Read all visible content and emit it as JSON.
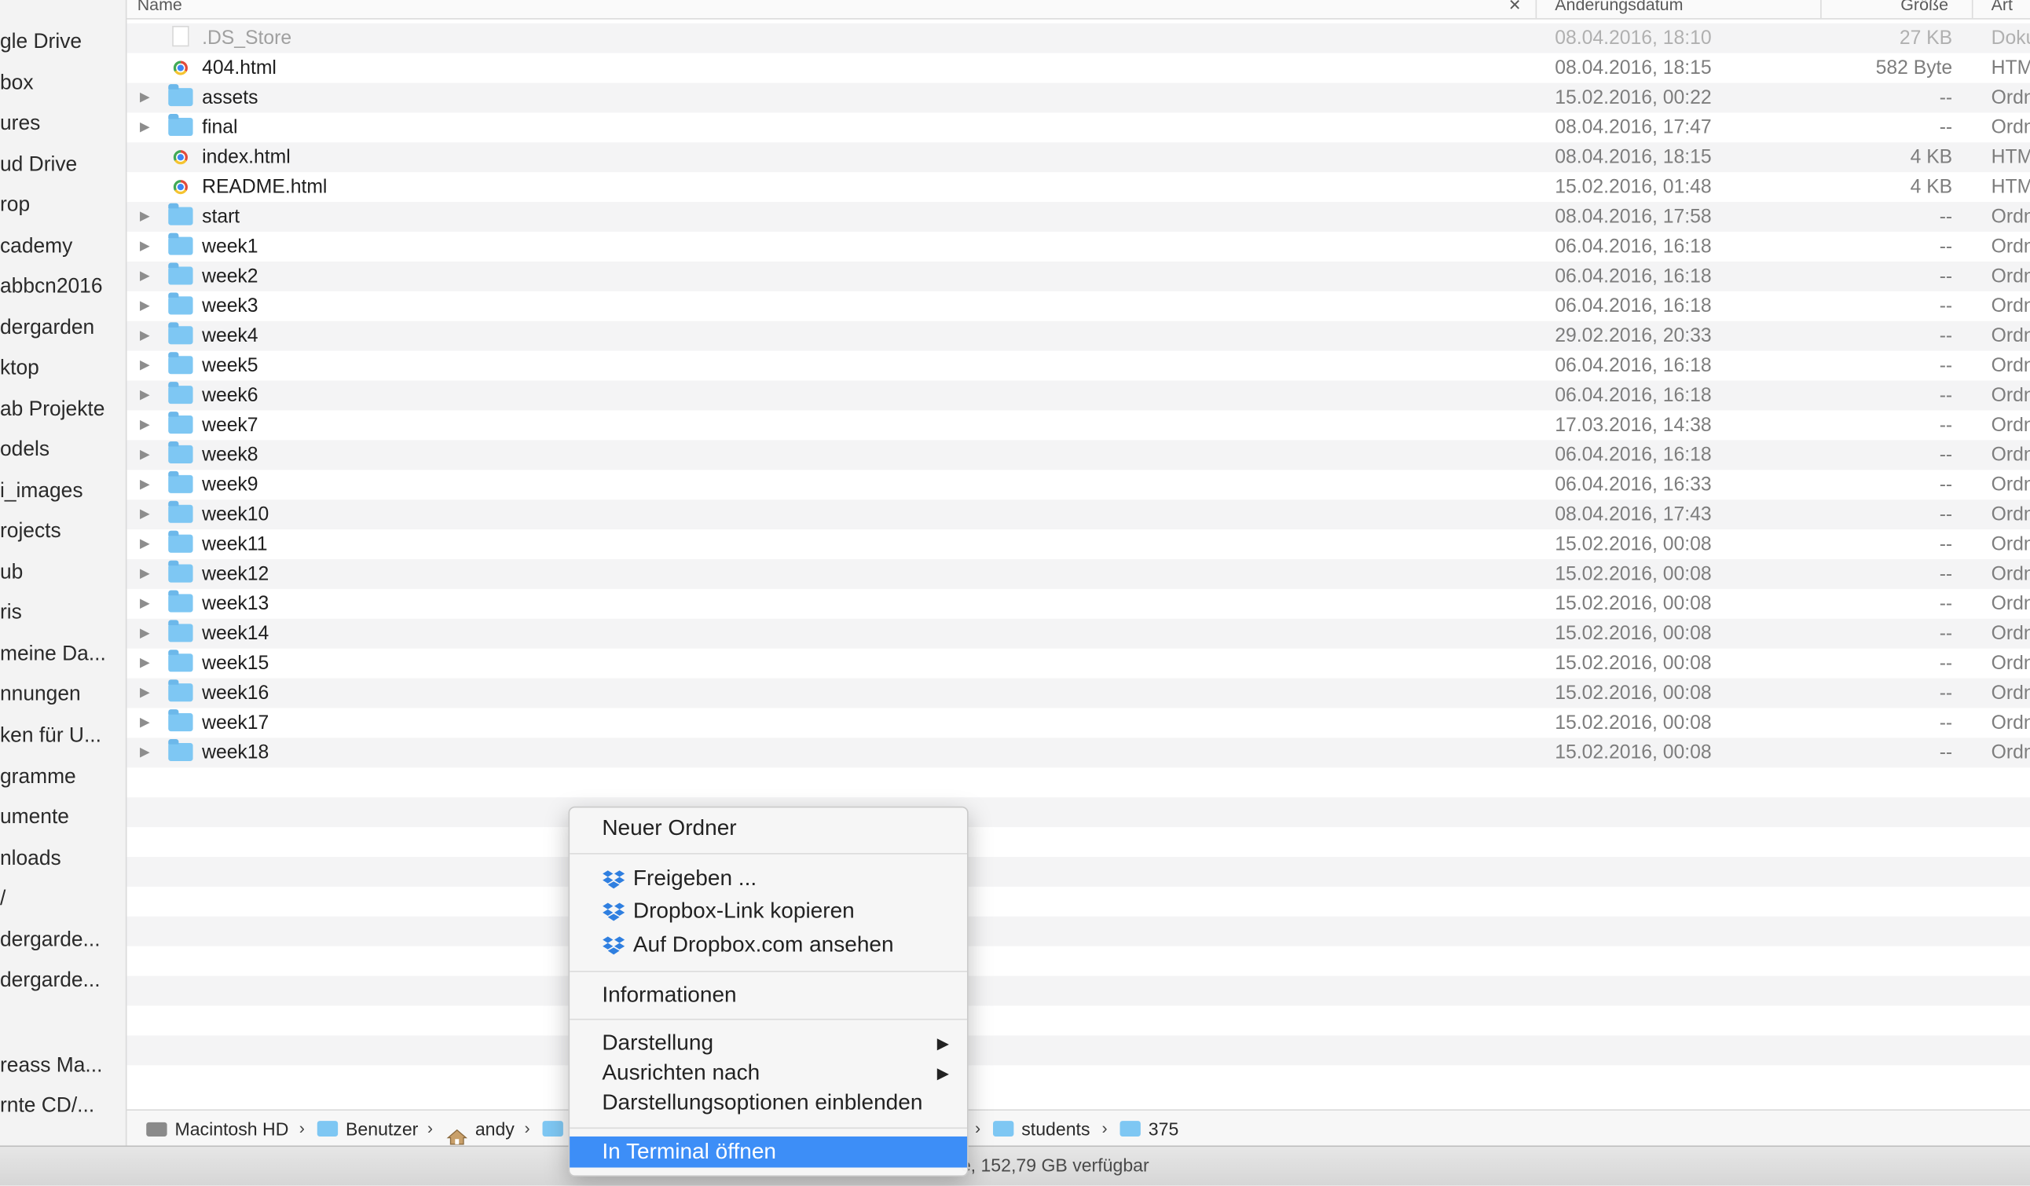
{
  "sidebar": {
    "items": [
      "gle Drive",
      "box",
      "ures",
      "ud Drive",
      "rop",
      "cademy",
      "abbcn2016",
      "dergarden",
      "ktop",
      "ab Projekte",
      "odels",
      "i_images",
      "rojects",
      "ub",
      "ris",
      "meine Da...",
      "nnungen",
      "ken für U...",
      "gramme",
      "umente",
      "nloads",
      "/",
      "dergarde...",
      "dergarde...",
      "",
      "reass Ma...",
      "rnte CD/..."
    ]
  },
  "header": {
    "name": "Name",
    "date": "Änderungsdatum",
    "size": "Größe",
    "kind": "Art"
  },
  "files": [
    {
      "name": ".DS_Store",
      "date": "08.04.2016, 18:10",
      "size": "27 KB",
      "kind": "Doku",
      "type": "doc",
      "expandable": false,
      "dim": true
    },
    {
      "name": "404.html",
      "date": "08.04.2016, 18:15",
      "size": "582 Byte",
      "kind": "HTM",
      "type": "html",
      "expandable": false
    },
    {
      "name": "assets",
      "date": "15.02.2016, 00:22",
      "size": "--",
      "kind": "Ordn",
      "type": "folder",
      "expandable": true
    },
    {
      "name": "final",
      "date": "08.04.2016, 17:47",
      "size": "--",
      "kind": "Ordn",
      "type": "folder",
      "expandable": true
    },
    {
      "name": "index.html",
      "date": "08.04.2016, 18:15",
      "size": "4 KB",
      "kind": "HTM",
      "type": "html",
      "expandable": false
    },
    {
      "name": "README.html",
      "date": "15.02.2016, 01:48",
      "size": "4 KB",
      "kind": "HTM",
      "type": "html",
      "expandable": false
    },
    {
      "name": "start",
      "date": "08.04.2016, 17:58",
      "size": "--",
      "kind": "Ordn",
      "type": "folder",
      "expandable": true
    },
    {
      "name": "week1",
      "date": "06.04.2016, 16:18",
      "size": "--",
      "kind": "Ordn",
      "type": "folder",
      "expandable": true
    },
    {
      "name": "week2",
      "date": "06.04.2016, 16:18",
      "size": "--",
      "kind": "Ordn",
      "type": "folder",
      "expandable": true
    },
    {
      "name": "week3",
      "date": "06.04.2016, 16:18",
      "size": "--",
      "kind": "Ordn",
      "type": "folder",
      "expandable": true
    },
    {
      "name": "week4",
      "date": "29.02.2016, 20:33",
      "size": "--",
      "kind": "Ordn",
      "type": "folder",
      "expandable": true
    },
    {
      "name": "week5",
      "date": "06.04.2016, 16:18",
      "size": "--",
      "kind": "Ordn",
      "type": "folder",
      "expandable": true
    },
    {
      "name": "week6",
      "date": "06.04.2016, 16:18",
      "size": "--",
      "kind": "Ordn",
      "type": "folder",
      "expandable": true
    },
    {
      "name": "week7",
      "date": "17.03.2016, 14:38",
      "size": "--",
      "kind": "Ordn",
      "type": "folder",
      "expandable": true
    },
    {
      "name": "week8",
      "date": "06.04.2016, 16:18",
      "size": "--",
      "kind": "Ordn",
      "type": "folder",
      "expandable": true
    },
    {
      "name": "week9",
      "date": "06.04.2016, 16:33",
      "size": "--",
      "kind": "Ordn",
      "type": "folder",
      "expandable": true
    },
    {
      "name": "week10",
      "date": "08.04.2016, 17:43",
      "size": "--",
      "kind": "Ordn",
      "type": "folder",
      "expandable": true
    },
    {
      "name": "week11",
      "date": "15.02.2016, 00:08",
      "size": "--",
      "kind": "Ordn",
      "type": "folder",
      "expandable": true
    },
    {
      "name": "week12",
      "date": "15.02.2016, 00:08",
      "size": "--",
      "kind": "Ordn",
      "type": "folder",
      "expandable": true
    },
    {
      "name": "week13",
      "date": "15.02.2016, 00:08",
      "size": "--",
      "kind": "Ordn",
      "type": "folder",
      "expandable": true
    },
    {
      "name": "week14",
      "date": "15.02.2016, 00:08",
      "size": "--",
      "kind": "Ordn",
      "type": "folder",
      "expandable": true
    },
    {
      "name": "week15",
      "date": "15.02.2016, 00:08",
      "size": "--",
      "kind": "Ordn",
      "type": "folder",
      "expandable": true
    },
    {
      "name": "week16",
      "date": "15.02.2016, 00:08",
      "size": "--",
      "kind": "Ordn",
      "type": "folder",
      "expandable": true
    },
    {
      "name": "week17",
      "date": "15.02.2016, 00:08",
      "size": "--",
      "kind": "Ordn",
      "type": "folder",
      "expandable": true
    },
    {
      "name": "week18",
      "date": "15.02.2016, 00:08",
      "size": "--",
      "kind": "Ordn",
      "type": "folder",
      "expandable": true
    }
  ],
  "pathbar": {
    "crumbs": [
      {
        "label": "Macintosh HD",
        "icon": "hard-drive-icon"
      },
      {
        "label": "Benutzer",
        "icon": "folder-icon"
      },
      {
        "label": "andy",
        "icon": "home-icon"
      },
      {
        "label": "",
        "icon": "folder-icon"
      },
      {
        "label": "students",
        "icon": "folder-icon"
      },
      {
        "label": "375",
        "icon": "folder-icon"
      }
    ]
  },
  "status": {
    "text": "e, 152,79 GB verfügbar"
  },
  "context_menu": {
    "new_folder": "Neuer Ordner",
    "share": "Freigeben ...",
    "copy_dropbox_link": "Dropbox-Link kopieren",
    "view_on_dropbox": "Auf Dropbox.com ansehen",
    "info": "Informationen",
    "view": "Darstellung",
    "arrange_by": "Ausrichten nach",
    "show_view_options": "Darstellungsoptionen einblenden",
    "open_in_terminal": "In Terminal öffnen"
  },
  "colors": {
    "highlight": "#3d8ef7",
    "folder": "#7ec7f3",
    "dropbox": "#2f7fe0"
  }
}
